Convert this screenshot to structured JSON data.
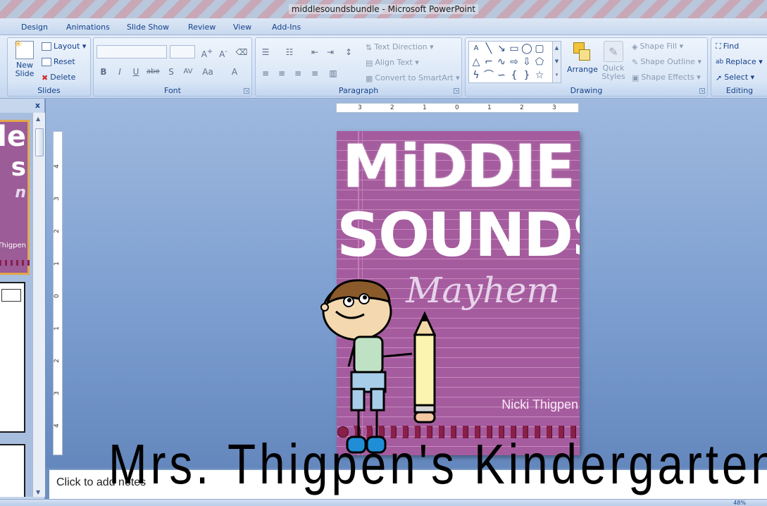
{
  "window": {
    "title": "middlesoundsbundle - Microsoft PowerPoint"
  },
  "tabs": [
    "Design",
    "Animations",
    "Slide Show",
    "Review",
    "View",
    "Add-Ins"
  ],
  "ribbon": {
    "slides": {
      "label": "Slides",
      "new_slide": "New Slide",
      "layout": "Layout",
      "reset": "Reset",
      "delete": "Delete"
    },
    "font": {
      "label": "Font"
    },
    "paragraph": {
      "label": "Paragraph",
      "text_direction": "Text Direction",
      "align_text": "Align Text",
      "convert_smartart": "Convert to SmartArt"
    },
    "drawing": {
      "label": "Drawing",
      "arrange": "Arrange",
      "quick_styles": "Quick Styles",
      "shape_fill": "Shape Fill",
      "shape_outline": "Shape Outline",
      "shape_effects": "Shape Effects"
    },
    "editing": {
      "label": "Editing",
      "find": "Find",
      "replace": "Replace",
      "select": "Select"
    }
  },
  "ruler": {
    "h_ticks": [
      "3",
      "2",
      "1",
      "0",
      "1",
      "2",
      "3"
    ],
    "v_ticks": [
      "4",
      "3",
      "2",
      "1",
      "0",
      "1",
      "2",
      "3",
      "4"
    ]
  },
  "slide": {
    "title_line1": "MiDDIE",
    "title_line2": "SOUNDS",
    "title_line3": "Mayhem",
    "author": "Nicki Thigpen"
  },
  "thumbnail": {
    "author_fragment": "Thigpen",
    "title_fragment": "le"
  },
  "notes": {
    "placeholder": "Click to add notes"
  },
  "status": {
    "zoom": "48%"
  },
  "watermark": "Mrs. Thigpen's Kindergarten"
}
